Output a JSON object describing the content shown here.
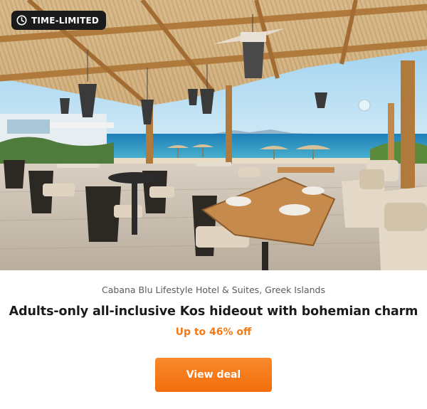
{
  "badge": {
    "label": "TIME-LIMITED",
    "icon": "clock-icon"
  },
  "deal": {
    "hotel_name": "Cabana Blu Lifestyle Hotel & Suites, Greek Islands",
    "headline": "Adults-only all-inclusive Kos hideout with bohemian charm",
    "discount": "Up to 46% off",
    "cta_label": "View deal"
  },
  "colors": {
    "accent": "#f47a17",
    "button": "#f47a17",
    "badge_background": "#1b1b1b",
    "headline_text": "#1a1a1a",
    "subtext": "#5b5b5b"
  }
}
